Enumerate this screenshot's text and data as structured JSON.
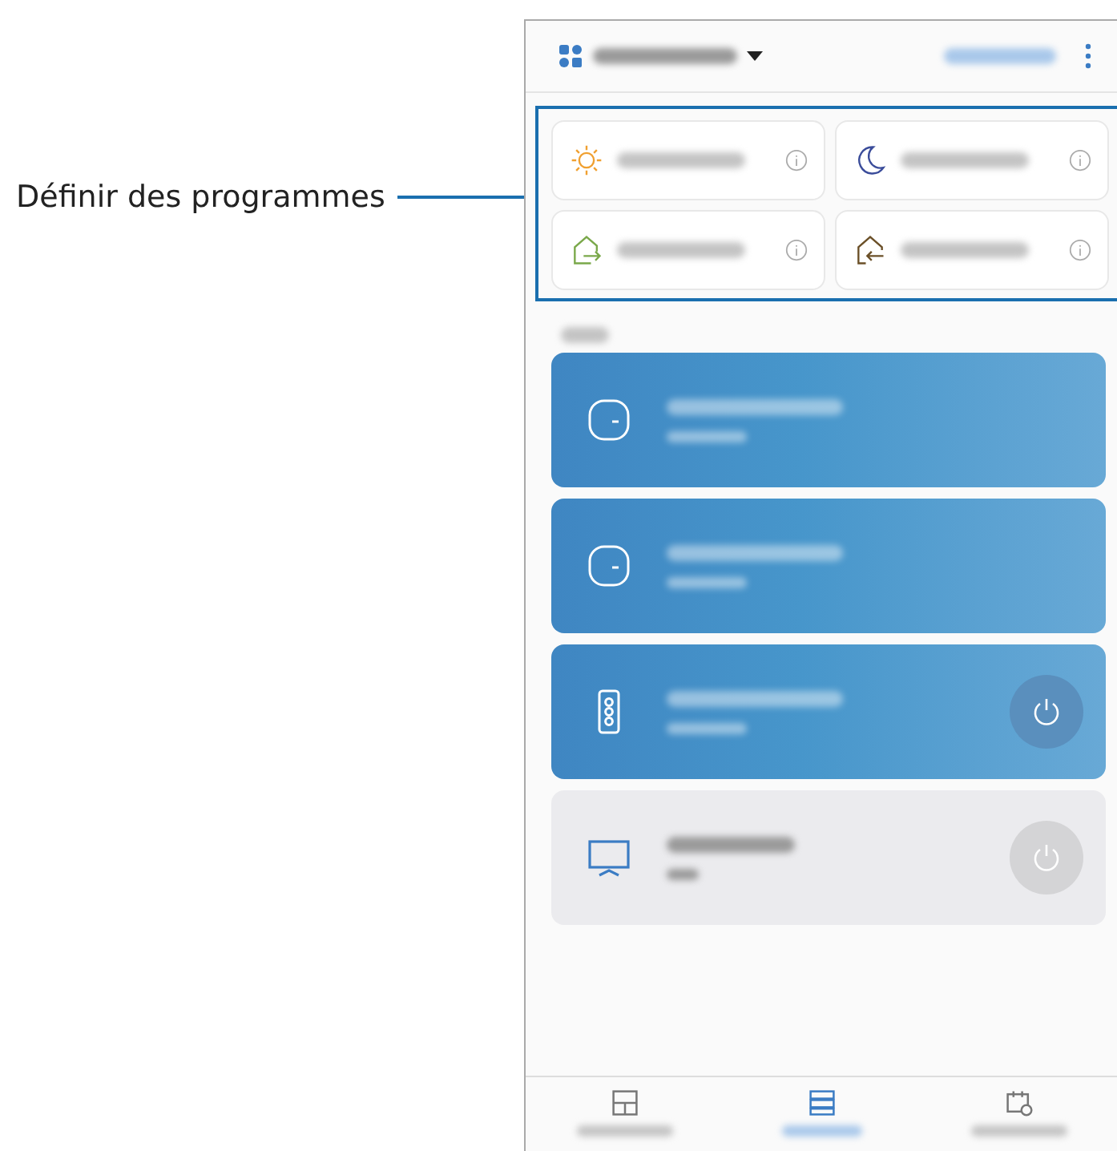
{
  "callout": {
    "label": "Définir des programmes"
  },
  "scenes": [
    {
      "kind": "sun"
    },
    {
      "kind": "moon"
    },
    {
      "kind": "leave"
    },
    {
      "kind": "arrive"
    }
  ],
  "devices": [
    {
      "kind": "hub",
      "on": true
    },
    {
      "kind": "hub",
      "on": true
    },
    {
      "kind": "speaker",
      "on": true
    },
    {
      "kind": "tv",
      "on": false
    }
  ],
  "nav_tabs": [
    {
      "kind": "dashboard",
      "selected": false
    },
    {
      "kind": "devices",
      "selected": true
    },
    {
      "kind": "automations",
      "selected": false
    }
  ]
}
